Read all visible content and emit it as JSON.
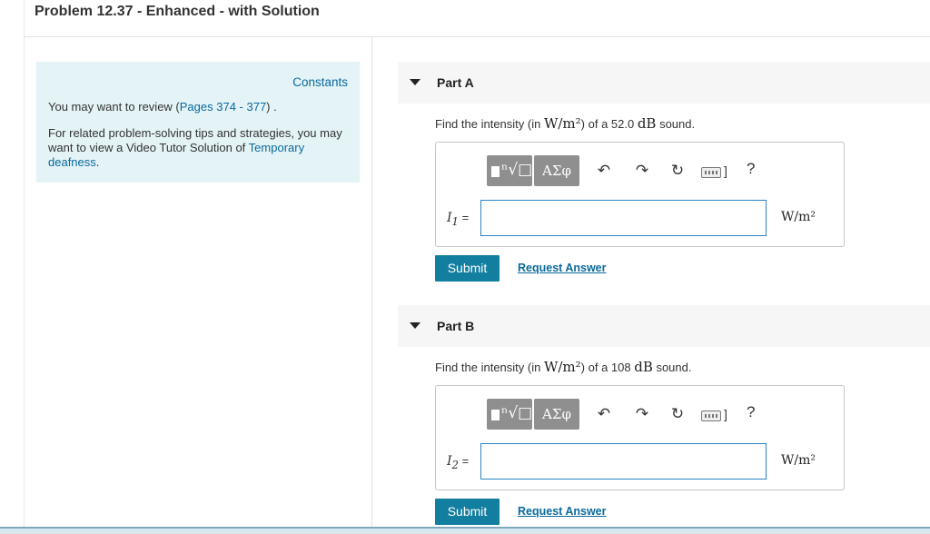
{
  "page": {
    "title": "Problem 12.37 - Enhanced - with Solution"
  },
  "sidebar": {
    "constants_label": "Constants",
    "review_prefix": "You may want to review (",
    "review_link": "Pages 374 - 377",
    "review_suffix": ") .",
    "related_text": "For related problem-solving tips and strategies, you may want to view a Video Tutor Solution of ",
    "related_link": "Temporary deafness",
    "related_end": "."
  },
  "toolbar": {
    "template_glyph": "ⁿ√□",
    "greek_label": "ΑΣφ",
    "undo_icon": "↶",
    "redo_icon": "↷",
    "reset_icon": "↻",
    "keyboard_tail": "]",
    "help_icon": "?"
  },
  "parts": [
    {
      "title": "Part A",
      "question_prefix": "Find the intensity (in ",
      "question_unit": "W/m²",
      "question_mid": ") of a 52.0 ",
      "question_db": "dB",
      "question_suffix": " sound.",
      "var_label": "I",
      "var_sub": "1",
      "var_eq": " =",
      "input_value": "",
      "unit": "W/m²",
      "submit_label": "Submit",
      "request_label": "Request Answer"
    },
    {
      "title": "Part B",
      "question_prefix": "Find the intensity (in ",
      "question_unit": "W/m²",
      "question_mid": ") of a 108 ",
      "question_db": "dB",
      "question_suffix": " sound.",
      "var_label": "I",
      "var_sub": "2",
      "var_eq": " =",
      "input_value": "",
      "unit": "W/m²",
      "submit_label": "Submit",
      "request_label": "Request Answer"
    }
  ],
  "colors": {
    "accent": "#127ea0",
    "link": "#0a6a9c",
    "sidebar_bg": "#e4f3f6",
    "toolbar_button": "#8f8f8f"
  }
}
